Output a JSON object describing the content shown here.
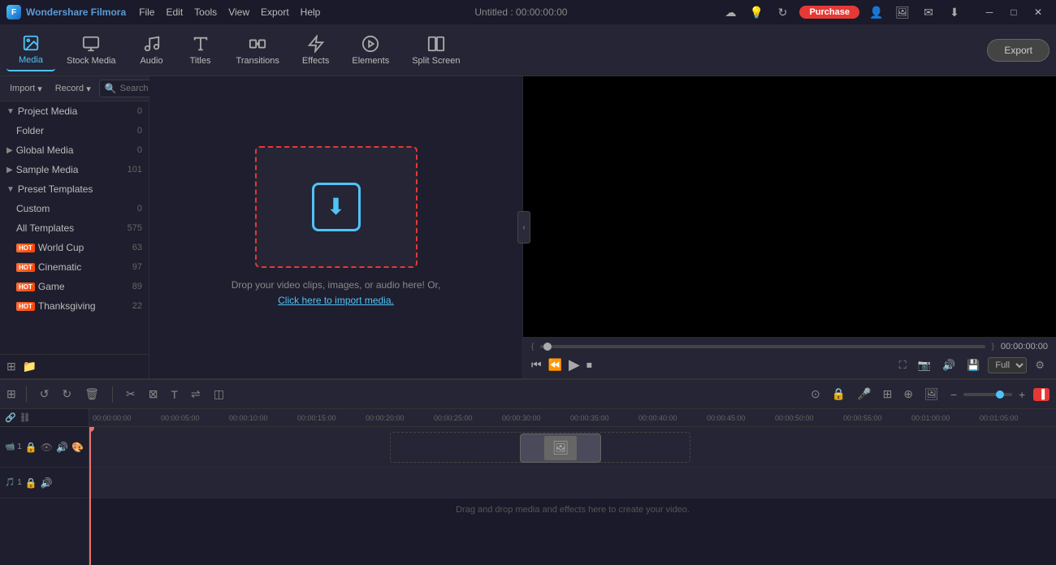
{
  "app": {
    "name": "Wondershare Filmora",
    "title": "Untitled : 00:00:00:00"
  },
  "menu": {
    "items": [
      "File",
      "Edit",
      "Tools",
      "View",
      "Export",
      "Help"
    ]
  },
  "titlebar": {
    "purchase_label": "Purchase"
  },
  "toolbar": {
    "items": [
      {
        "id": "media",
        "label": "Media",
        "active": true
      },
      {
        "id": "stock-media",
        "label": "Stock Media"
      },
      {
        "id": "audio",
        "label": "Audio"
      },
      {
        "id": "titles",
        "label": "Titles"
      },
      {
        "id": "transitions",
        "label": "Transitions"
      },
      {
        "id": "effects",
        "label": "Effects"
      },
      {
        "id": "elements",
        "label": "Elements"
      },
      {
        "id": "split-screen",
        "label": "Split Screen"
      }
    ],
    "export_label": "Export"
  },
  "panel": {
    "import_label": "Import",
    "record_label": "Record",
    "search_placeholder": "Search media",
    "tree": [
      {
        "label": "Project Media",
        "count": "0",
        "expanded": true,
        "level": 0,
        "arrow": "▼"
      },
      {
        "label": "Folder",
        "count": "0",
        "level": 1,
        "arrow": ""
      },
      {
        "label": "Global Media",
        "count": "0",
        "level": 0,
        "arrow": "▶"
      },
      {
        "label": "Sample Media",
        "count": "101",
        "level": 0,
        "arrow": "▶"
      },
      {
        "label": "Preset Templates",
        "count": "",
        "level": 0,
        "arrow": "▼",
        "expanded": true
      },
      {
        "label": "Custom",
        "count": "0",
        "level": 1
      },
      {
        "label": "All Templates",
        "count": "575",
        "level": 1
      },
      {
        "label": "World Cup",
        "count": "63",
        "level": 1,
        "hot": true
      },
      {
        "label": "Cinematic",
        "count": "97",
        "level": 1,
        "hot": true
      },
      {
        "label": "Game",
        "count": "89",
        "level": 1,
        "hot": true
      },
      {
        "label": "Thanksgiving",
        "count": "22",
        "level": 1,
        "hot": true
      }
    ]
  },
  "drop_zone": {
    "text": "Drop your video clips, images, or audio here! Or,",
    "link_text": "Click here to import media."
  },
  "preview": {
    "time": "00:00:00:00",
    "quality": "Full"
  },
  "timeline": {
    "ruler_ticks": [
      "00:00:05:00",
      "00:00:10:00",
      "00:00:15:00",
      "00:00:20:00",
      "00:00:25:00",
      "00:00:30:00",
      "00:00:35:00",
      "00:00:40:00",
      "00:00:45:00",
      "00:00:50:00",
      "00:00:55:00",
      "00:01:00:00",
      "00:01:05:00"
    ],
    "drag_drop_text": "Drag and drop media and effects here to create your video."
  }
}
